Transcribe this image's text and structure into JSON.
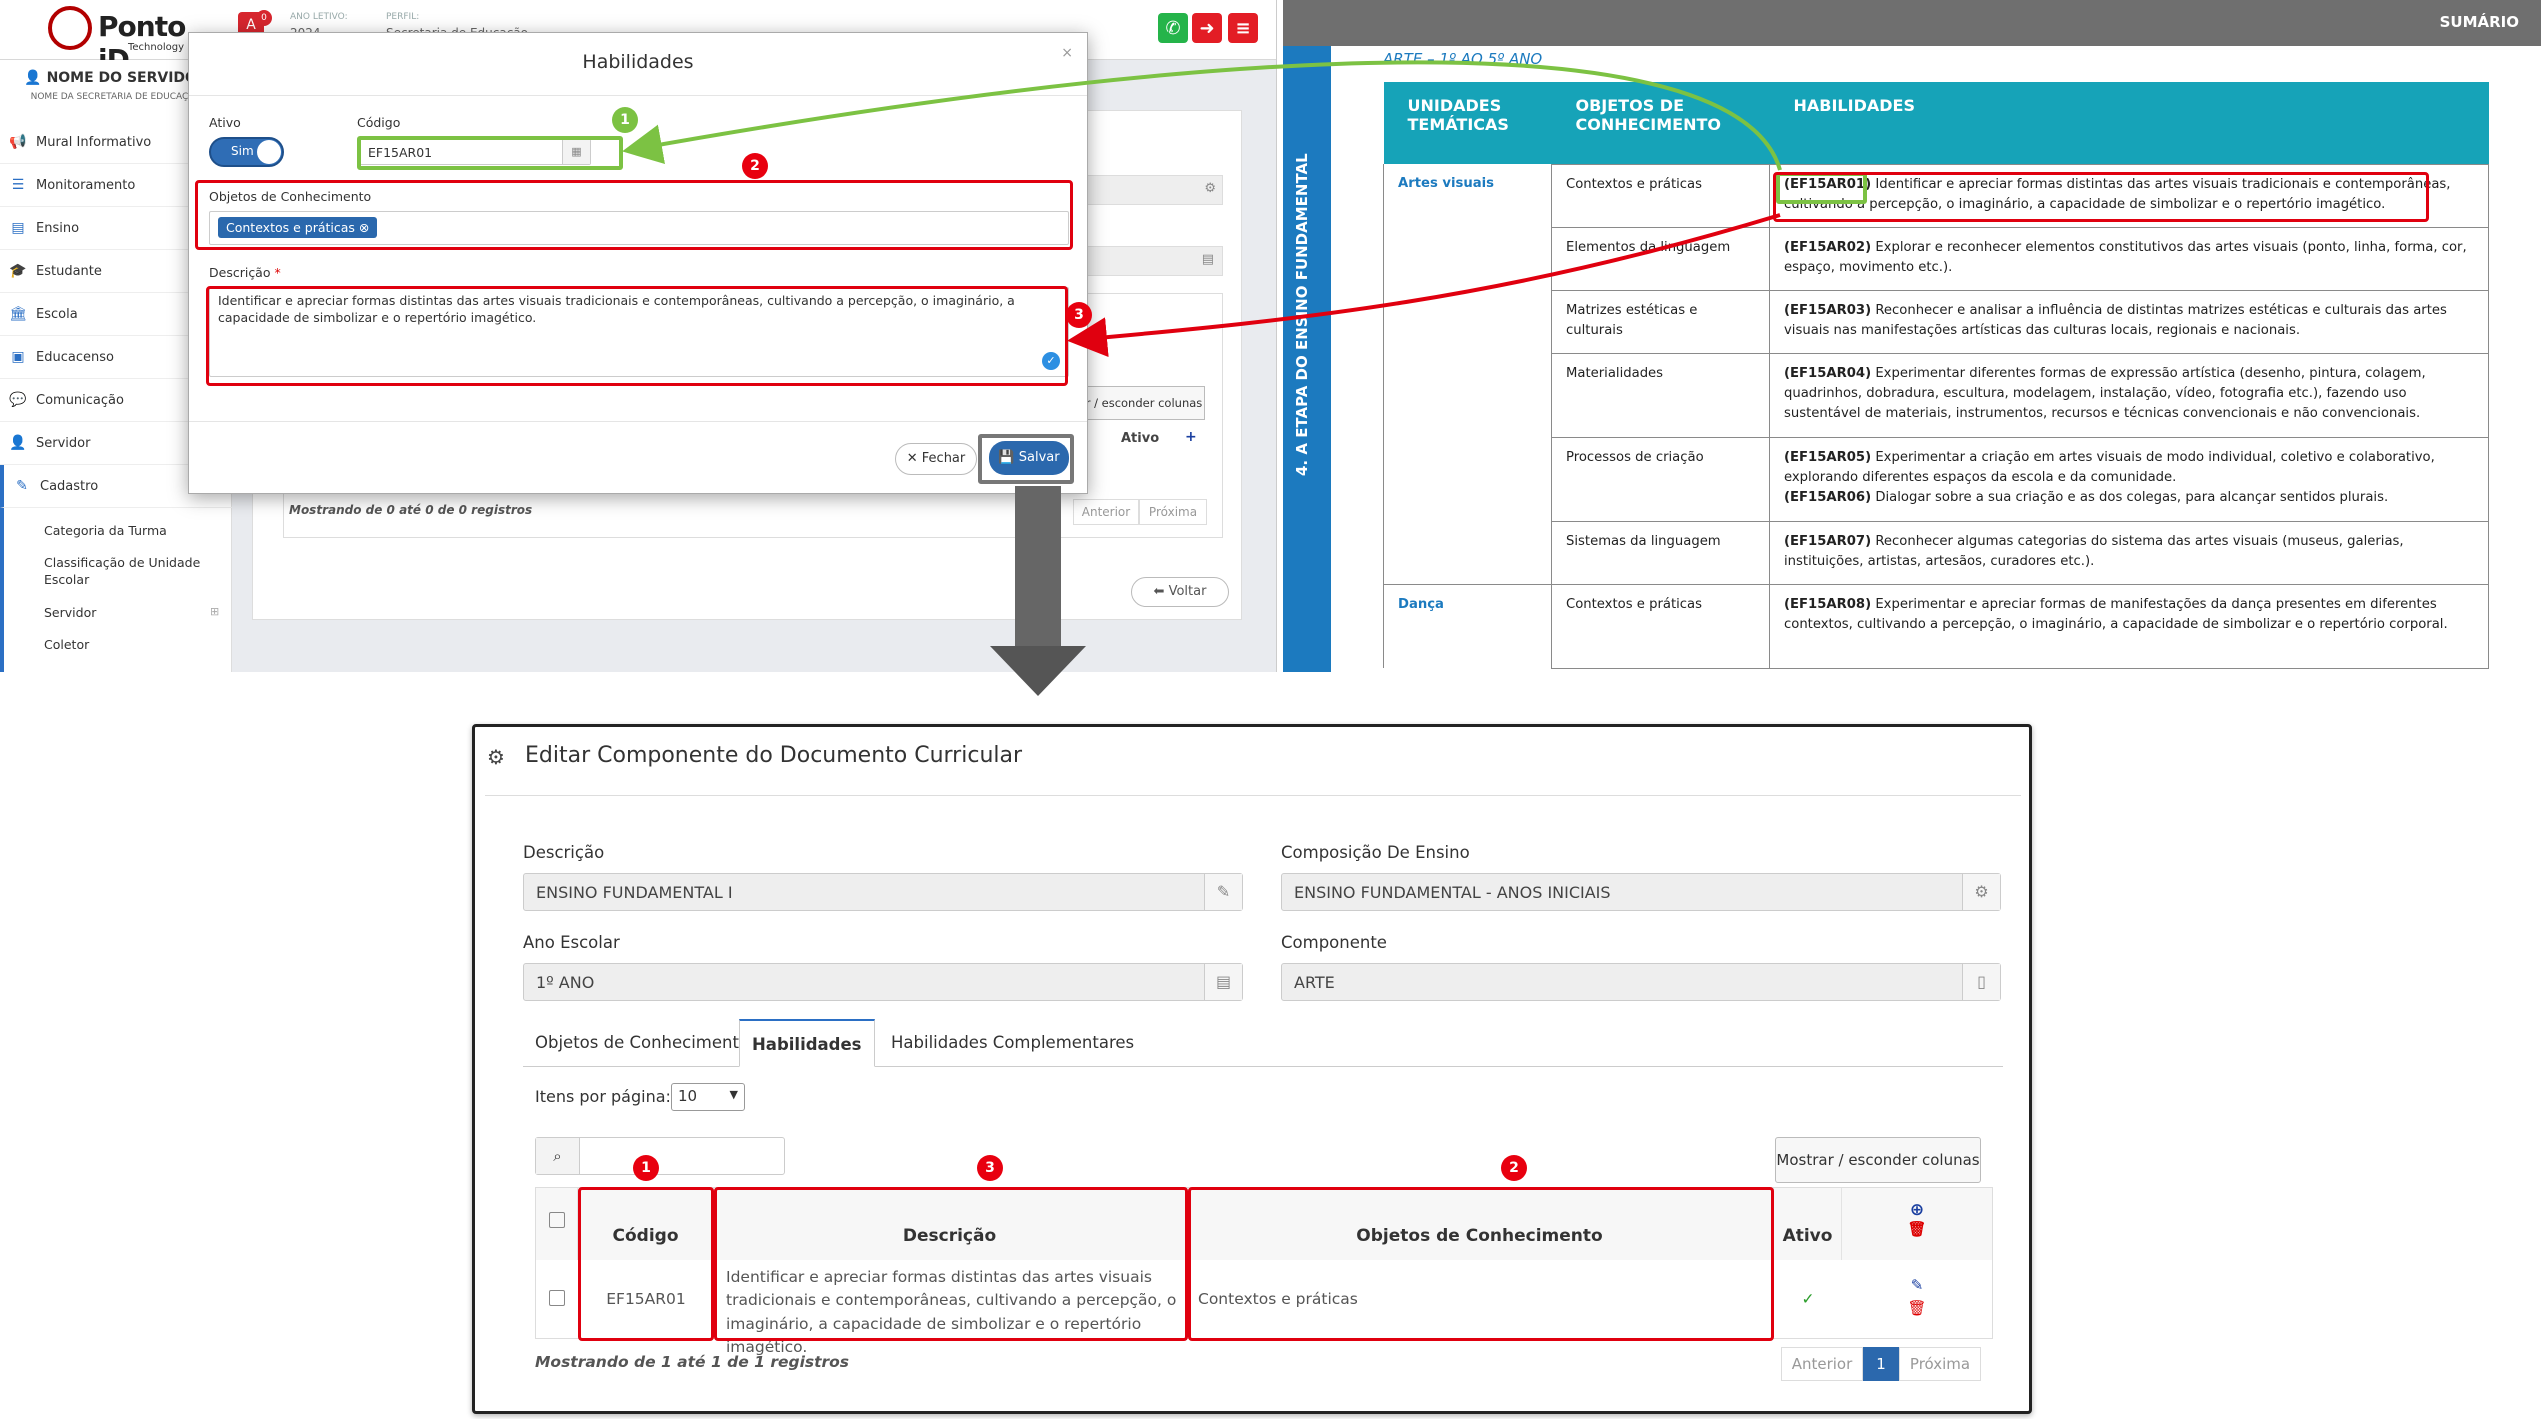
{
  "app": {
    "logo_text": "Ponto iD",
    "logo_sub": "Technology",
    "badge_count": "0",
    "ano_letivo_label": "ANO LETIVO:",
    "ano_letivo_value": "2024",
    "perfil_label": "PERFIL:",
    "perfil_value": "Secretaria de Educação",
    "user_name": "NOME DO SERVIDOR",
    "user_school": "NOME DA SECRETARIA DE EDUCAÇÃO",
    "sidebar": [
      {
        "label": "Mural Informativo",
        "icon": "megaphone-icon"
      },
      {
        "label": "Monitoramento",
        "icon": "sliders-icon"
      },
      {
        "label": "Ensino",
        "icon": "book-icon"
      },
      {
        "label": "Estudante",
        "icon": "graduation-cap-icon"
      },
      {
        "label": "Escola",
        "icon": "building-icon"
      },
      {
        "label": "Educacenso",
        "icon": "monitor-icon"
      },
      {
        "label": "Comunicação",
        "icon": "chat-icon"
      },
      {
        "label": "Servidor",
        "icon": "user-icon"
      },
      {
        "label": "Cadastro",
        "icon": "edit-icon"
      }
    ],
    "subitems": [
      "Categoria da Turma",
      "Classificação de Unidade Escolar",
      "Servidor",
      "Coletor"
    ],
    "bg": {
      "toggle_cols": "r / esconder colunas",
      "ativo_col": "Ativo",
      "showing": "Mostrando de 0 até 0 de 0 registros",
      "prev": "Anterior",
      "next": "Próxima",
      "voltar": "Voltar"
    }
  },
  "modal": {
    "title": "Habilidades",
    "ativo_label": "Ativo",
    "toggle_label": "Sim",
    "codigo_label": "Código",
    "codigo_value": "EF15AR01",
    "objetos_label": "Objetos de Conhecimento",
    "objetos_chip": "Contextos e práticas",
    "descricao_label": "Descrição",
    "descricao_required": "*",
    "descricao_value": "Identificar e apreciar formas distintas das artes visuais tradicionais e contemporâneas, cultivando a percepção, o imaginário, a capacidade de simbolizar e o repertório imagético.",
    "fechar": "Fechar",
    "salvar": "Salvar"
  },
  "doc": {
    "header": "SUMÁRIO",
    "vertical": "4. A ETAPA DO ENSINO FUNDAMENTAL",
    "subtitle": "ARTE – 1º AO 5º ANO",
    "columns": [
      "UNIDADES TEMÁTICAS",
      "OBJETOS DE CONHECIMENTO",
      "HABILIDADES"
    ],
    "rows": [
      {
        "unidade": "Artes visuais",
        "objeto": "Contextos e práticas",
        "code": "(EF15AR01)",
        "text": " Identificar e apreciar formas distintas das artes visuais tradicionais e contemporâneas, cultivando a percepção, o imaginário, a capacidade de simbolizar e o repertório imagético."
      },
      {
        "unidade": "",
        "objeto": "Elementos da linguagem",
        "code": "(EF15AR02)",
        "text": " Explorar e reconhecer elementos constitutivos das artes visuais (ponto, linha, forma, cor, espaço, movimento etc.)."
      },
      {
        "unidade": "",
        "objeto": "Matrizes estéticas e culturais",
        "code": "(EF15AR03)",
        "text": " Reconhecer e analisar a influência de distintas matrizes estéticas e culturais das artes visuais nas manifestações artísticas das culturas locais, regionais e nacionais."
      },
      {
        "unidade": "",
        "objeto": "Materialidades",
        "code": "(EF15AR04)",
        "text": " Experimentar diferentes formas de expressão artística (desenho, pintura, colagem, quadrinhos, dobradura, escultura, modelagem, instalação, vídeo, fotografia etc.), fazendo uso sustentável de materiais, instrumentos, recursos e técnicas convencionais e não convencionais."
      },
      {
        "unidade": "",
        "objeto": "Processos de criação",
        "code": "(EF15AR05)",
        "text": " Experimentar a criação em artes visuais de modo individual, coletivo e colaborativo, explorando diferentes espaços da escola e da comunidade.",
        "code2": "(EF15AR06)",
        "text2": " Dialogar sobre a sua criação e as dos colegas, para alcançar sentidos plurais."
      },
      {
        "unidade": "",
        "objeto": "Sistemas da linguagem",
        "code": "(EF15AR07)",
        "text": " Reconhecer algumas categorias do sistema das artes visuais (museus, galerias, instituições, artistas, artesãos, curadores etc.)."
      },
      {
        "unidade": "Dança",
        "objeto": "Contextos e práticas",
        "code": "(EF15AR08)",
        "text": " Experimentar e apreciar formas de manifestações da dança presentes em diferentes contextos, cultivando a percepção, o imaginário, a capacidade de simbolizar e o repertório corporal."
      }
    ]
  },
  "bottom": {
    "title": "Editar Componente do Documento Curricular",
    "descricao_label": "Descrição",
    "descricao_value": "ENSINO FUNDAMENTAL I",
    "composicao_label": "Composição De Ensino",
    "composicao_value": "ENSINO FUNDAMENTAL - ANOS INICIAIS",
    "ano_label": "Ano Escolar",
    "ano_value": "1º ANO",
    "componente_label": "Componente",
    "componente_value": "ARTE",
    "tabs": [
      "Objetos de Conhecimento",
      "Habilidades",
      "Habilidades Complementares"
    ],
    "per_page_label": "Itens por página:",
    "per_page_value": "10",
    "toggle_cols": "Mostrar / esconder colunas",
    "columns": {
      "codigo": "Código",
      "descricao": "Descrição",
      "objetos": "Objetos de Conhecimento",
      "ativo": "Ativo"
    },
    "row": {
      "codigo": "EF15AR01",
      "descricao": "Identificar e apreciar formas distintas das artes visuais tradicionais e contemporâneas, cultivando a percepção, o imaginário, a capacidade de simbolizar e o repertório imagético.",
      "objetos": "Contextos e práticas"
    },
    "showing": "Mostrando de 1 até 1 de 1 registros",
    "prev": "Anterior",
    "page": "1",
    "next": "Próxima"
  },
  "annotations": {
    "one": "1",
    "two": "2",
    "three": "3"
  },
  "colors": {
    "primary": "#2b68ad",
    "annotation_red": "#e0000f",
    "annotation_green": "#7cc243",
    "doc_header": "#16a3b8"
  }
}
